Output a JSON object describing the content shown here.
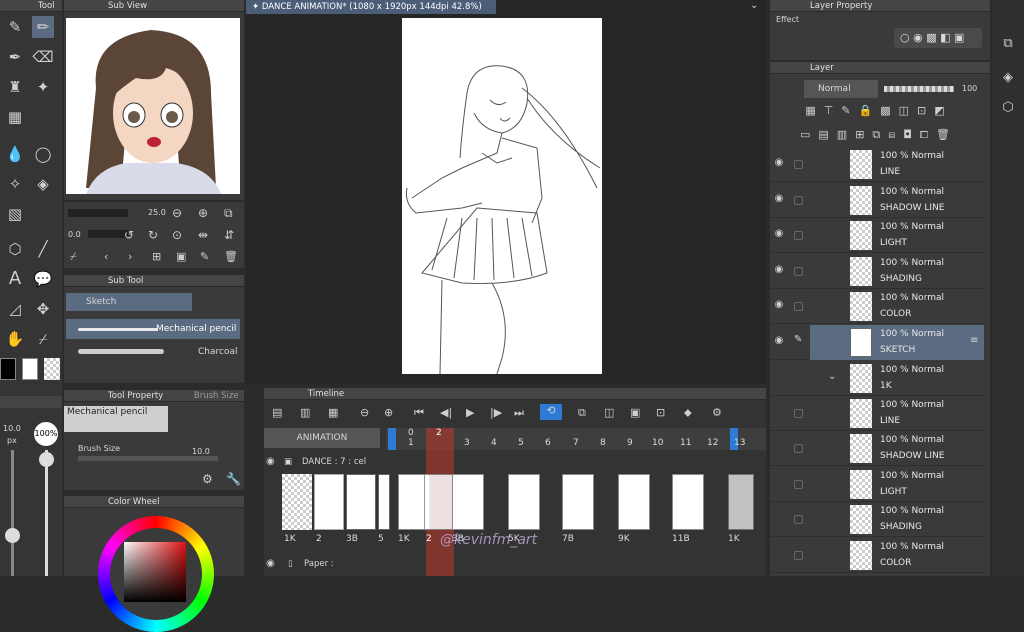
{
  "tool_panel": {
    "title": "Tool"
  },
  "subview": {
    "title": "Sub View"
  },
  "brush_controls": {
    "size_value": "25.0",
    "opacity_value": "0.0"
  },
  "subtool": {
    "title": "Sub Tool",
    "active_group": "Sketch",
    "items": [
      "Mechanical pencil",
      "Charcoal"
    ]
  },
  "tool_property": {
    "title": "Tool Property",
    "tab2": "Brush Size",
    "tool_name": "Mechanical pencil",
    "brush_size_label": "Brush Size",
    "brush_size_value": "10.0"
  },
  "color_wheel": {
    "title": "Color Wheel"
  },
  "left_sliders": {
    "size_value": "10.0",
    "size_unit": "px",
    "opacity_value": "100",
    "opacity_unit": "%"
  },
  "canvas_tab": {
    "title": "DANCE ANIMATION* (1080 x 1920px 144dpi 42.8%)"
  },
  "layer_property": {
    "title": "Layer Property",
    "effect_label": "Effect"
  },
  "layer_panel": {
    "title": "Layer",
    "blend_mode": "Normal",
    "opacity": "100",
    "layers": [
      {
        "opacity": "100 %  Normal",
        "name": "LINE"
      },
      {
        "opacity": "100 %  Normal",
        "name": "SHADOW LINE"
      },
      {
        "opacity": "100 %  Normal",
        "name": "LIGHT"
      },
      {
        "opacity": "100 %  Normal",
        "name": "SHADING"
      },
      {
        "opacity": "100 %  Normal",
        "name": "COLOR"
      },
      {
        "opacity": "100 %  Normal",
        "name": "SKETCH"
      },
      {
        "opacity": "100 %  Normal",
        "name": "1K"
      },
      {
        "opacity": "100 %  Normal",
        "name": "LINE"
      },
      {
        "opacity": "100 %  Normal",
        "name": "SHADOW LINE"
      },
      {
        "opacity": "100 %  Normal",
        "name": "LIGHT"
      },
      {
        "opacity": "100 %  Normal",
        "name": "SHADING"
      },
      {
        "opacity": "100 %  Normal",
        "name": "COLOR"
      }
    ]
  },
  "timeline": {
    "title": "Timeline",
    "name": "ANIMATION",
    "frame_numbers": [
      "0",
      "1",
      "2",
      "3",
      "4",
      "5",
      "6",
      "7",
      "8",
      "9",
      "10",
      "11",
      "12",
      "13"
    ],
    "track1": "DANCE : 7 : cel",
    "track2": "Paper :",
    "cel_labels_left": [
      "1K",
      "2",
      "3B",
      "5"
    ],
    "cel_labels_right": [
      "1K",
      "2",
      "3B",
      "5K",
      "7B",
      "9K",
      "11B",
      "1K"
    ],
    "watermark": "@kevinfm_art"
  },
  "colors": {
    "accent": "#5b6b82",
    "playhead": "#c0392b",
    "selection_blue": "#2e7bd6"
  }
}
